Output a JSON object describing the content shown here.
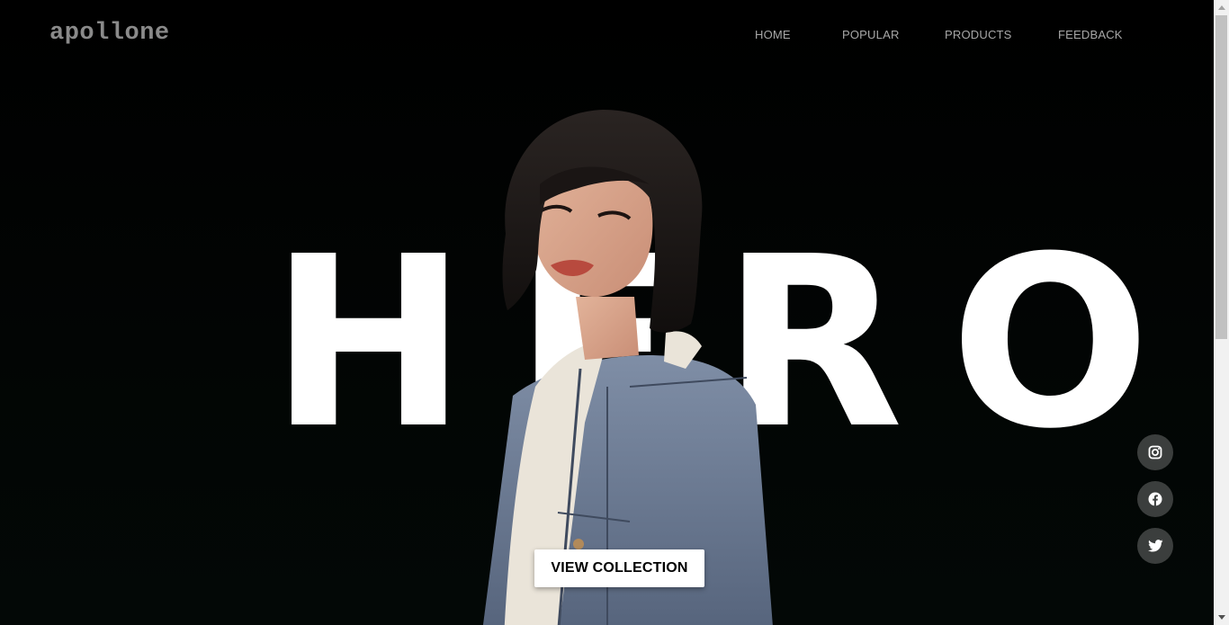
{
  "brand": {
    "logo_text": "apollone"
  },
  "nav": {
    "items": [
      {
        "label": "HOME"
      },
      {
        "label": "POPULAR"
      },
      {
        "label": "PRODUCTS"
      },
      {
        "label": "FEEDBACK"
      }
    ]
  },
  "hero": {
    "headline": "HERO",
    "cta_label": "VIEW COLLECTION"
  },
  "social": {
    "items": [
      {
        "icon": "instagram-icon"
      },
      {
        "icon": "facebook-icon"
      },
      {
        "icon": "twitter-icon"
      }
    ]
  },
  "colors": {
    "background": "#000000",
    "logo": "#8a8a8a",
    "nav_text": "#a7a7a7",
    "headline": "#ffffff",
    "cta_background": "#ffffff",
    "social_circle": "#3b3e3d"
  }
}
